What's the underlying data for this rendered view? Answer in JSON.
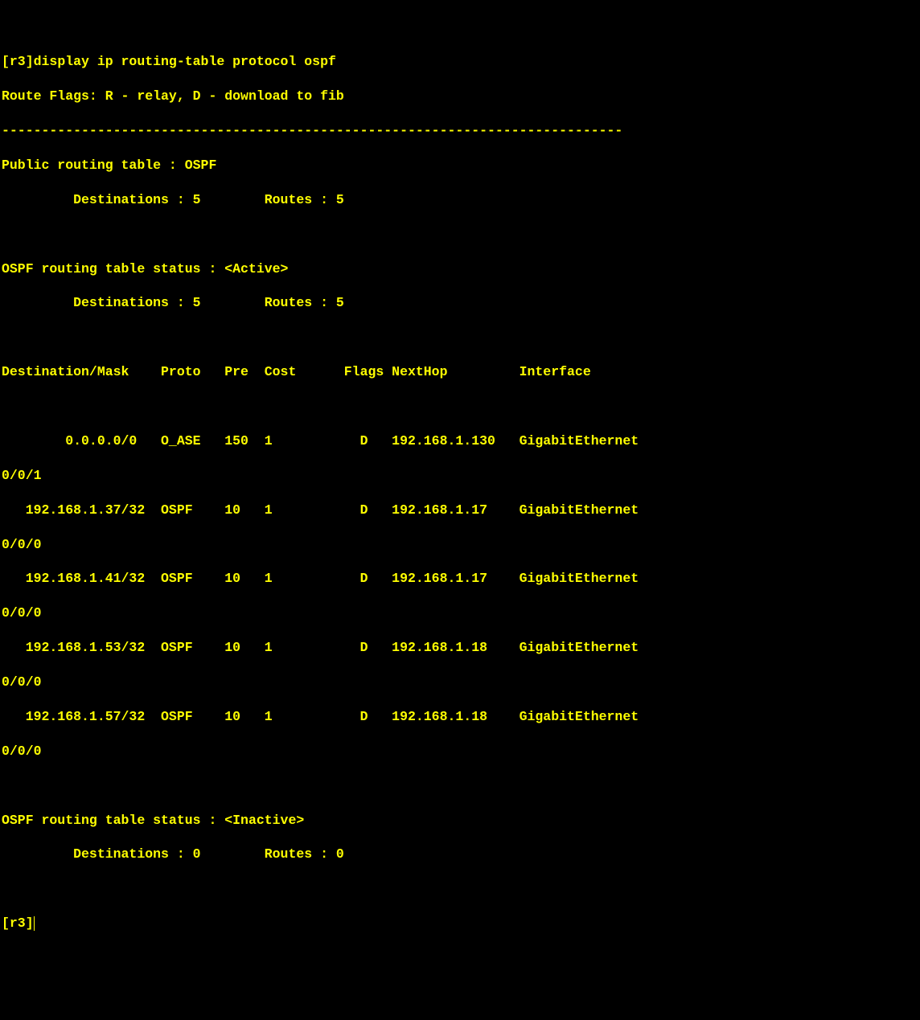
{
  "prompt1": "[r3]",
  "command": "display ip routing-table protocol ospf",
  "route_flags_label": "Route Flags: R - relay, D - download to fib",
  "separator": "------------------------------------------------------------------------------",
  "public_routing_table_label": "Public routing table : OSPF",
  "pub_dest_label": "         Destinations : 5        Routes : 5",
  "active_status_label": "OSPF routing table status : <Active>",
  "active_dest_label": "         Destinations : 5        Routes : 5",
  "headers": "Destination/Mask    Proto   Pre  Cost      Flags NextHop         Interface",
  "rows": [
    {
      "a": "        0.0.0.0/0   O_ASE   150  1           D   192.168.1.130   GigabitEthernet",
      "b": "0/0/1"
    },
    {
      "a": "   192.168.1.37/32  OSPF    10   1           D   192.168.1.17    GigabitEthernet",
      "b": "0/0/0"
    },
    {
      "a": "   192.168.1.41/32  OSPF    10   1           D   192.168.1.17    GigabitEthernet",
      "b": "0/0/0"
    },
    {
      "a": "   192.168.1.53/32  OSPF    10   1           D   192.168.1.18    GigabitEthernet",
      "b": "0/0/0"
    },
    {
      "a": "   192.168.1.57/32  OSPF    10   1           D   192.168.1.18    GigabitEthernet",
      "b": "0/0/0"
    }
  ],
  "inactive_status_label": "OSPF routing table status : <Inactive>",
  "inactive_dest_label": "         Destinations : 0        Routes : 0",
  "prompt2": "[r3]"
}
